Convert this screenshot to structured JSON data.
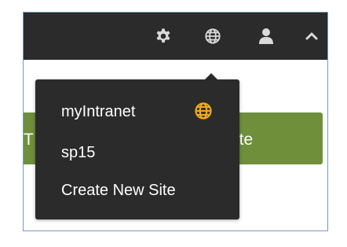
{
  "colors": {
    "topbar": "#2b2b2b",
    "icon": "#d9d9d9",
    "accent_green": "#6f8f3a",
    "globe_active": "#f0a81e",
    "border": "#6e9ec4"
  },
  "topbar": {
    "icons": [
      "gear-icon",
      "globe-icon",
      "user-icon",
      "chevron-up-icon"
    ]
  },
  "background_button": {
    "left_text": "T",
    "right_text": "ite"
  },
  "site_menu": {
    "items": [
      {
        "label": "myIntranet",
        "current": true,
        "icon": "globe-icon"
      },
      {
        "label": "sp15"
      },
      {
        "label": "Create New Site"
      }
    ]
  }
}
